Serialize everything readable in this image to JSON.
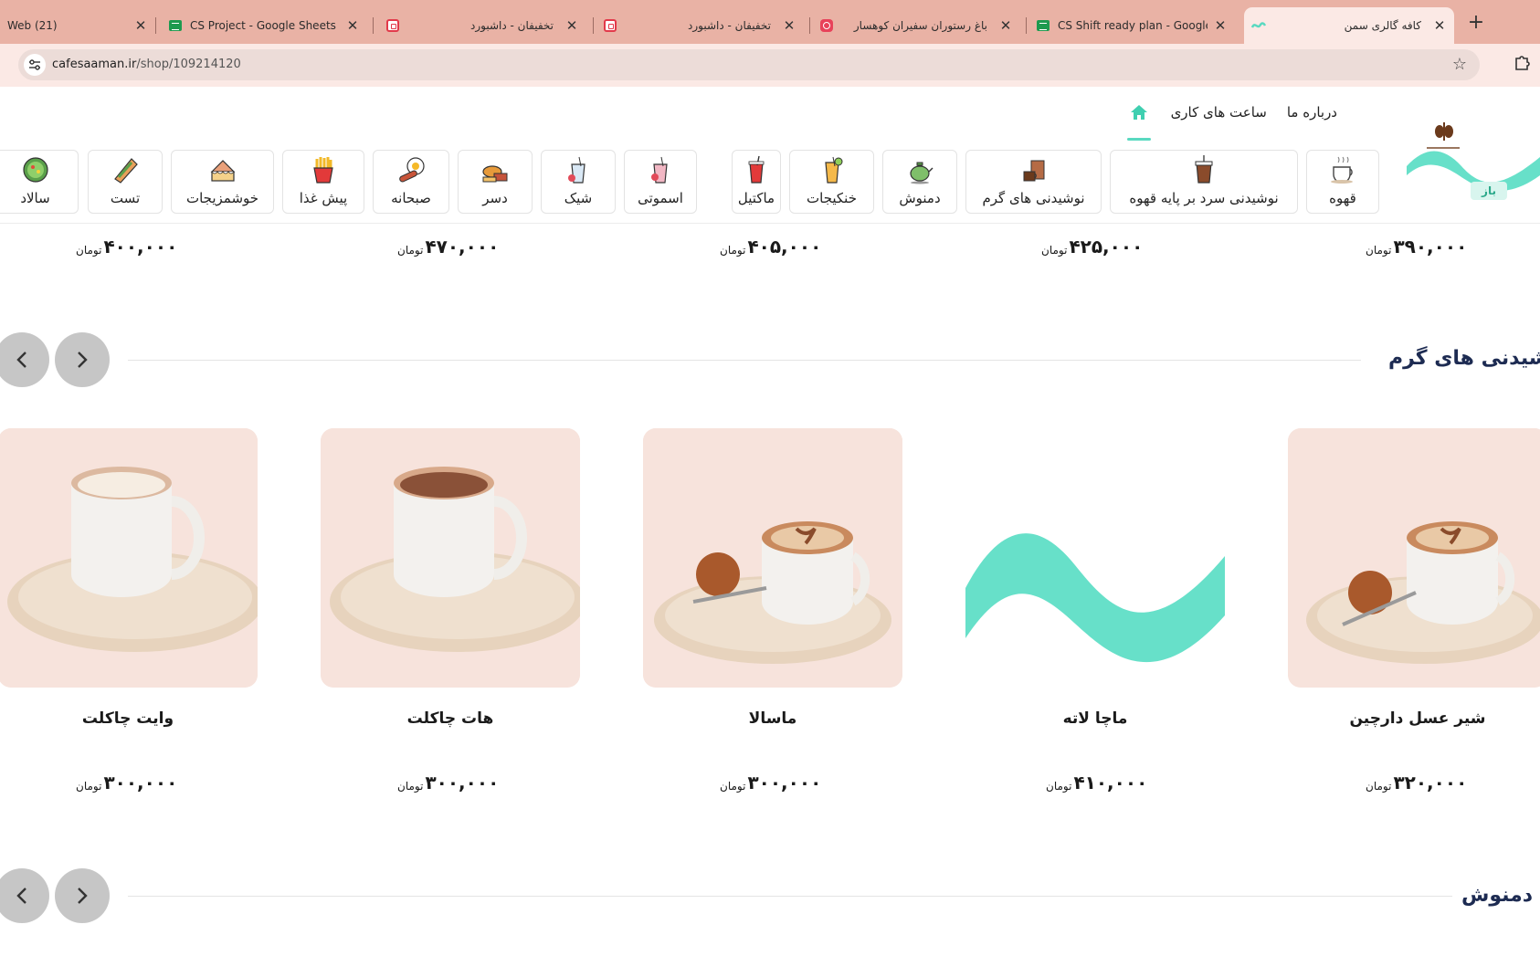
{
  "browser": {
    "tabs": [
      {
        "title": "Web (21)",
        "favicon": "web-icon"
      },
      {
        "title": "CS Project - Google Sheets",
        "favicon": "sheets-icon"
      },
      {
        "title": "تخفیفان - داشبورد",
        "favicon": "calendar-icon"
      },
      {
        "title": "تخفیفان - داشبورد",
        "favicon": "calendar-icon"
      },
      {
        "title": "باغ رستوران سفیران کوهسار",
        "favicon": "instagram-icon"
      },
      {
        "title": "CS Shift ready plan - Google Sh",
        "favicon": "sheets-icon"
      },
      {
        "title": "کافه گالری سمن",
        "favicon": "saman-icon",
        "active": true
      }
    ],
    "url_host": "cafesaaman.ir",
    "url_path": "/shop/109214120"
  },
  "header": {
    "nav": [
      "ساعت های کاری",
      "درباره ما"
    ],
    "status_badge": "باز",
    "categories": [
      {
        "label": "قهوه",
        "icon": "coffee-cup-icon"
      },
      {
        "label": "نوشیدنی سرد بر پایه قهوه",
        "icon": "iced-coffee-icon"
      },
      {
        "label": "نوشیدنی های گرم",
        "icon": "hot-drink-icon"
      },
      {
        "label": "دمنوش",
        "icon": "teapot-icon"
      },
      {
        "label": "خنکیجات",
        "icon": "cold-drink-icon"
      },
      {
        "label": "ماکتیل",
        "icon": "mocktail-icon"
      },
      {
        "label": "اسموتی",
        "icon": "smoothie-icon"
      },
      {
        "label": "شیک",
        "icon": "shake-icon"
      },
      {
        "label": "دسر",
        "icon": "dessert-icon"
      },
      {
        "label": "صبحانه",
        "icon": "breakfast-icon"
      },
      {
        "label": "پیش غذا",
        "icon": "fries-icon"
      },
      {
        "label": "خوشمزیجات",
        "icon": "cake-icon"
      },
      {
        "label": "تست",
        "icon": "toast-icon"
      },
      {
        "label": "سالاد",
        "icon": "salad-icon"
      }
    ]
  },
  "currency": "تومان",
  "prev_row_prices": [
    "۳۹۰,۰۰۰",
    "۴۲۵,۰۰۰",
    "۴۰۵,۰۰۰",
    "۴۷۰,۰۰۰",
    "۴۰۰,۰۰۰"
  ],
  "hot_drinks": {
    "title": "نوشیدنی های گرم",
    "products": [
      {
        "name": "شیر عسل دارچین",
        "price": "۳۲۰,۰۰۰",
        "image": "cappuccino-cookie"
      },
      {
        "name": "ماچا لاته",
        "price": "۴۱۰,۰۰۰",
        "image": "placeholder-logo"
      },
      {
        "name": "ماسالا",
        "price": "۳۰۰,۰۰۰",
        "image": "cappuccino-cookie"
      },
      {
        "name": "هات چاکلت",
        "price": "۳۰۰,۰۰۰",
        "image": "hot-chocolate"
      },
      {
        "name": "وایت چاکلت",
        "price": "۳۰۰,۰۰۰",
        "image": "white-chocolate"
      }
    ]
  },
  "next_section": {
    "title": "دمنوش"
  },
  "colors": {
    "accent": "#59d9c0",
    "title": "#1d2b52",
    "tabbar": "#e9b2a5"
  }
}
